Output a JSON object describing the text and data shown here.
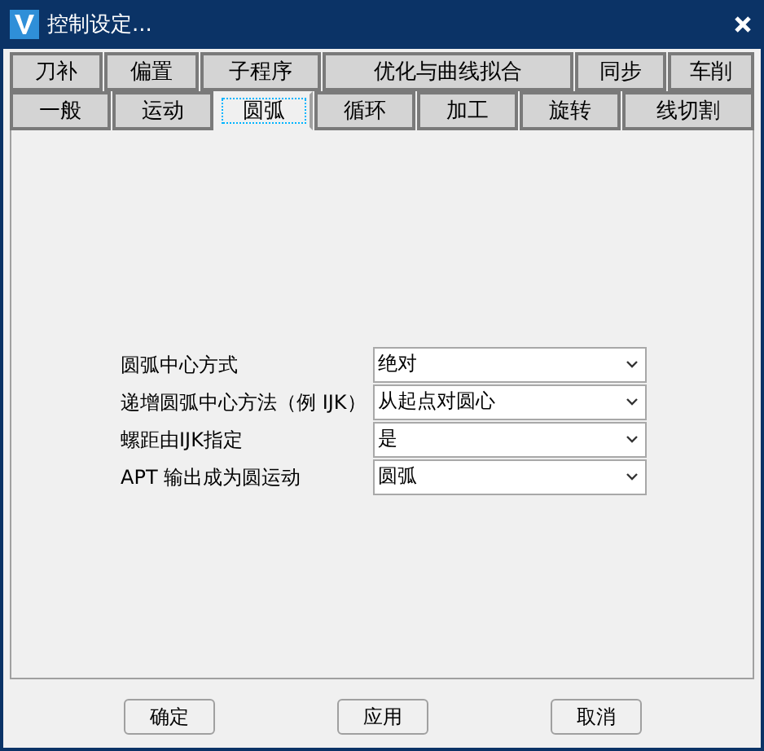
{
  "window": {
    "title": "控制设定..."
  },
  "tab_rows": [
    [
      {
        "label": "刀补",
        "selected": false
      },
      {
        "label": "偏置",
        "selected": false
      },
      {
        "label": "子程序",
        "selected": false
      },
      {
        "label": "优化与曲线拟合",
        "selected": false
      },
      {
        "label": "同步",
        "selected": false
      },
      {
        "label": "车削",
        "selected": false
      }
    ],
    [
      {
        "label": "一般",
        "selected": false
      },
      {
        "label": "运动",
        "selected": false
      },
      {
        "label": "圆弧",
        "selected": true
      },
      {
        "label": "循环",
        "selected": false
      },
      {
        "label": "加工",
        "selected": false
      },
      {
        "label": "旋转",
        "selected": false
      },
      {
        "label": "线切割",
        "selected": false
      }
    ]
  ],
  "fields": [
    {
      "label": "圆弧中心方式",
      "value": "绝对"
    },
    {
      "label": "递增圆弧中心方法（例 IJK）",
      "value": "从起点对圆心"
    },
    {
      "label": "螺距由IJK指定",
      "value": "是"
    },
    {
      "label": "APT 输出成为圆运动",
      "value": "圆弧"
    }
  ],
  "buttons": [
    "确定",
    "应用",
    "取消"
  ]
}
